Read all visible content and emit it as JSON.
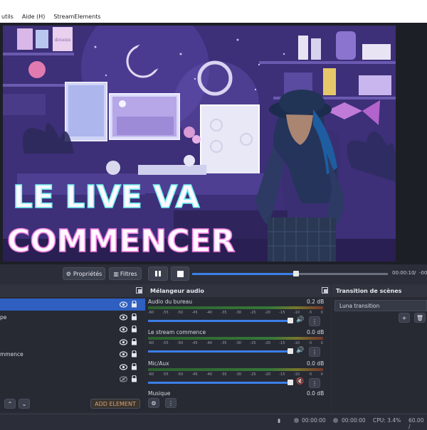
{
  "menubar": {
    "items": [
      "utils",
      "Aide (H)",
      "StreamElements"
    ]
  },
  "preview": {
    "overlay_line1": "LE LIVE VA",
    "overlay_line2": "COMMENCER",
    "poster_text": "dreams"
  },
  "controls": {
    "properties_label": "Propriétés",
    "filters_label": "Filtres",
    "time_current": "00:00:10",
    "time_separator": "/",
    "time_total": "-00:",
    "seek_progress": 0.53
  },
  "sources": {
    "rows": [
      {
        "label": "",
        "selected": true,
        "hidden": false
      },
      {
        "label": "pe",
        "selected": false,
        "hidden": false
      },
      {
        "label": "",
        "selected": false,
        "hidden": false
      },
      {
        "label": "",
        "selected": false,
        "hidden": false
      },
      {
        "label": "mmence",
        "selected": false,
        "hidden": false
      },
      {
        "label": "",
        "selected": false,
        "hidden": false
      },
      {
        "label": "",
        "selected": false,
        "hidden": true
      }
    ],
    "add_label": "ADD ELEMENT"
  },
  "mixer": {
    "title": "Mélangeur audio",
    "tick_labels": [
      "-60",
      "-55",
      "-50",
      "-45",
      "-40",
      "-35",
      "-30",
      "-25",
      "-20",
      "-15",
      "-10",
      "-5",
      "0"
    ],
    "channels": [
      {
        "name": "Audio du bureau",
        "db": "0.2 dB",
        "volume": 1.0,
        "muted": false
      },
      {
        "name": "Le stream commence",
        "db": "0.0 dB",
        "volume": 1.0,
        "muted": false
      },
      {
        "name": "Mic/Aux",
        "db": "0.0 dB",
        "volume": 1.0,
        "muted": true
      },
      {
        "name": "Musique",
        "db": "0.0 dB",
        "volume": 1.0,
        "muted": false
      }
    ]
  },
  "transitions": {
    "title": "Transition de scènes",
    "selected": "Luna transition"
  },
  "statusbar": {
    "rec_time": "00:00:00",
    "stream_time": "00:00:00",
    "cpu": "CPU: 3.4%",
    "fps": "60.00 /"
  },
  "colors": {
    "accent": "#3d7ee8",
    "selection": "#2e5fc1",
    "muted": "#e05050"
  }
}
